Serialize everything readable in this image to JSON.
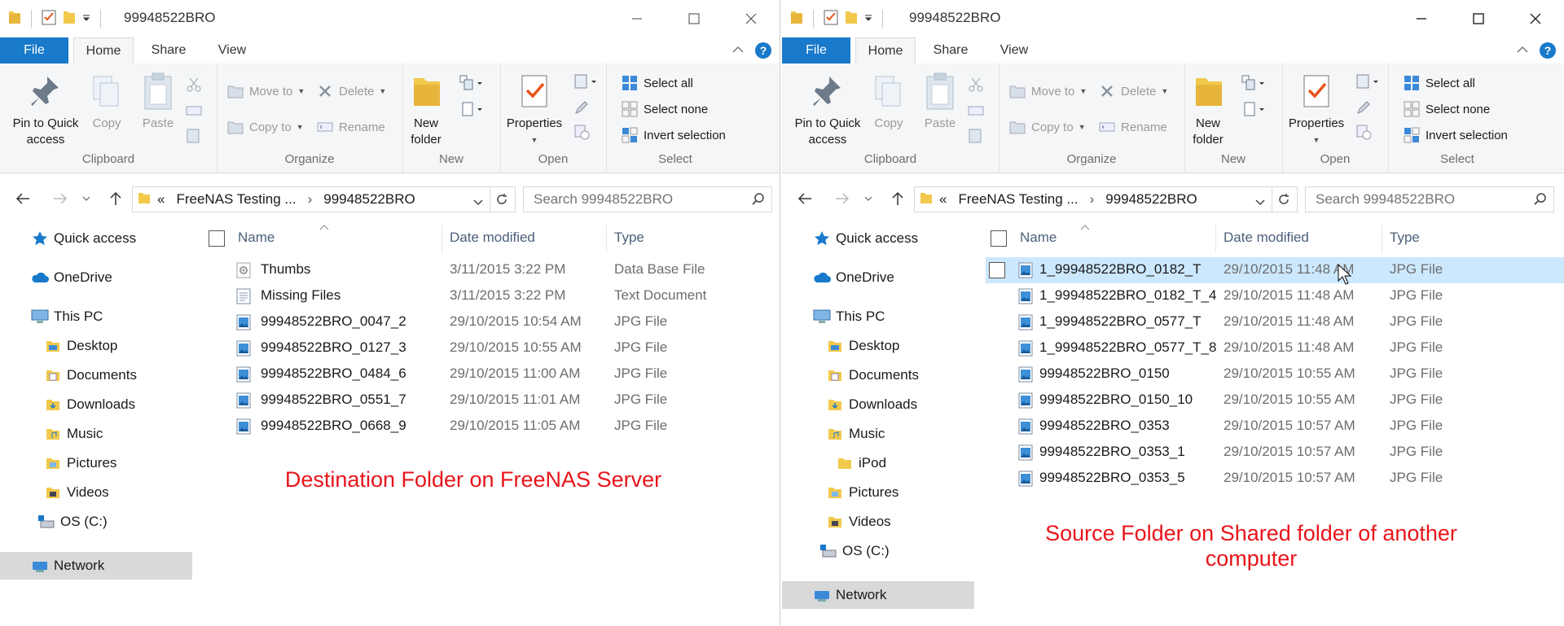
{
  "left": {
    "title": "99948522BRO",
    "tabs": {
      "file": "File",
      "home": "Home",
      "share": "Share",
      "view": "View"
    },
    "ribbon": {
      "pin": [
        "Pin to Quick",
        "access"
      ],
      "copy": "Copy",
      "paste": "Paste",
      "move_to": "Move to",
      "copy_to": "Copy to",
      "delete": "Delete",
      "rename": "Rename",
      "new_folder": [
        "New",
        "folder"
      ],
      "properties": "Properties",
      "select_all": "Select all",
      "select_none": "Select none",
      "invert": "Invert selection",
      "groups": {
        "clipboard": "Clipboard",
        "organize": "Organize",
        "new": "New",
        "open": "Open",
        "select": "Select"
      }
    },
    "address": {
      "prefix": "«",
      "seg1": "FreeNAS Testing ...",
      "seg2": "99948522BRO"
    },
    "search_placeholder": "Search 99948522BRO",
    "nav": [
      "Quick access",
      "OneDrive",
      "This PC",
      "Desktop",
      "Documents",
      "Downloads",
      "Music",
      "Pictures",
      "Videos",
      "OS (C:)",
      "Network"
    ],
    "columns": {
      "name": "Name",
      "date": "Date modified",
      "type": "Type"
    },
    "files": [
      {
        "name": "Thumbs",
        "date": "3/11/2015 3:22 PM",
        "type": "Data Base File",
        "icon": "database-icon"
      },
      {
        "name": "Missing Files",
        "date": "3/11/2015 3:22 PM",
        "type": "Text Document",
        "icon": "text-file-icon"
      },
      {
        "name": "99948522BRO_0047_2",
        "date": "29/10/2015 10:54 AM",
        "type": "JPG File",
        "icon": "image-file-icon"
      },
      {
        "name": "99948522BRO_0127_3",
        "date": "29/10/2015 10:55 AM",
        "type": "JPG File",
        "icon": "image-file-icon"
      },
      {
        "name": "99948522BRO_0484_6",
        "date": "29/10/2015 11:00 AM",
        "type": "JPG File",
        "icon": "image-file-icon"
      },
      {
        "name": "99948522BRO_0551_7",
        "date": "29/10/2015 11:01 AM",
        "type": "JPG File",
        "icon": "image-file-icon"
      },
      {
        "name": "99948522BRO_0668_9",
        "date": "29/10/2015 11:05 AM",
        "type": "JPG File",
        "icon": "image-file-icon"
      }
    ],
    "annotation": [
      "Destination Folder on FreeNAS Server"
    ]
  },
  "right": {
    "title": "99948522BRO",
    "tabs": {
      "file": "File",
      "home": "Home",
      "share": "Share",
      "view": "View"
    },
    "ribbon": {
      "pin": [
        "Pin to Quick",
        "access"
      ],
      "copy": "Copy",
      "paste": "Paste",
      "move_to": "Move to",
      "copy_to": "Copy to",
      "delete": "Delete",
      "rename": "Rename",
      "new_folder": [
        "New",
        "folder"
      ],
      "properties": "Properties",
      "select_all": "Select all",
      "select_none": "Select none",
      "invert": "Invert selection",
      "groups": {
        "clipboard": "Clipboard",
        "organize": "Organize",
        "new": "New",
        "open": "Open",
        "select": "Select"
      }
    },
    "address": {
      "prefix": "«",
      "seg1": "FreeNAS Testing ...",
      "seg2": "99948522BRO"
    },
    "search_placeholder": "Search 99948522BRO",
    "nav": [
      "Quick access",
      "OneDrive",
      "This PC",
      "Desktop",
      "Documents",
      "Downloads",
      "Music",
      "iPod",
      "Pictures",
      "Videos",
      "OS (C:)",
      "Network"
    ],
    "columns": {
      "name": "Name",
      "date": "Date modified",
      "type": "Type"
    },
    "files": [
      {
        "name": "1_99948522BRO_0182_T",
        "date": "29/10/2015 11:48 AM",
        "type": "JPG File",
        "icon": "image-file-icon"
      },
      {
        "name": "1_99948522BRO_0182_T_4",
        "date": "29/10/2015 11:48 AM",
        "type": "JPG File",
        "icon": "image-file-icon"
      },
      {
        "name": "1_99948522BRO_0577_T",
        "date": "29/10/2015 11:48 AM",
        "type": "JPG File",
        "icon": "image-file-icon"
      },
      {
        "name": "1_99948522BRO_0577_T_8",
        "date": "29/10/2015 11:48 AM",
        "type": "JPG File",
        "icon": "image-file-icon"
      },
      {
        "name": "99948522BRO_0150",
        "date": "29/10/2015 10:55 AM",
        "type": "JPG File",
        "icon": "image-file-icon"
      },
      {
        "name": "99948522BRO_0150_10",
        "date": "29/10/2015 10:55 AM",
        "type": "JPG File",
        "icon": "image-file-icon"
      },
      {
        "name": "99948522BRO_0353",
        "date": "29/10/2015 10:57 AM",
        "type": "JPG File",
        "icon": "image-file-icon"
      },
      {
        "name": "99948522BRO_0353_1",
        "date": "29/10/2015 10:57 AM",
        "type": "JPG File",
        "icon": "image-file-icon"
      },
      {
        "name": "99948522BRO_0353_5",
        "date": "29/10/2015 10:57 AM",
        "type": "JPG File",
        "icon": "image-file-icon"
      }
    ],
    "annotation": [
      "Source Folder on Shared folder of another",
      "computer"
    ]
  },
  "colors": {
    "accent": "#1979ca",
    "selection": "#cce8ff",
    "annotation": "#e8151b"
  }
}
